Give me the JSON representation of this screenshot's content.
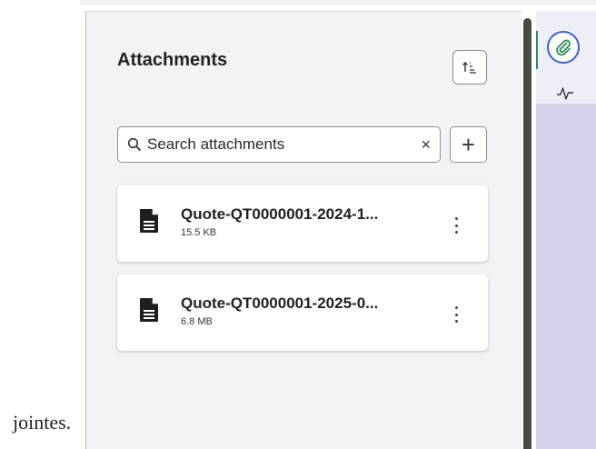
{
  "page": {
    "footnote": "jointes."
  },
  "panel": {
    "title": "Attachments",
    "sort_icon": "sort-icon"
  },
  "search": {
    "placeholder": "Search attachments",
    "value": "",
    "search_icon": "search-icon",
    "clear_icon": "close-icon",
    "clear_glyph": "×"
  },
  "add_button": {
    "icon": "plus-icon",
    "glyph": "+"
  },
  "attachments": [
    {
      "name": "Quote-QT0000001-2024-1...",
      "size": "15.5 KB",
      "icon": "document-icon"
    },
    {
      "name": "Quote-QT0000001-2025-0...",
      "size": "6.8 MB",
      "icon": "document-icon"
    }
  ],
  "rail": {
    "tabs": [
      {
        "icon": "paperclip-icon",
        "active": true
      },
      {
        "icon": "activity-icon",
        "active": false
      }
    ]
  },
  "colors": {
    "panel_bg": "#f3f3f7",
    "rail_bg": "#d3d4ec",
    "active_tab_ring": "#3d5fd9",
    "active_indicator": "#2e8b57",
    "scrollbar": "#4a4a4a"
  }
}
